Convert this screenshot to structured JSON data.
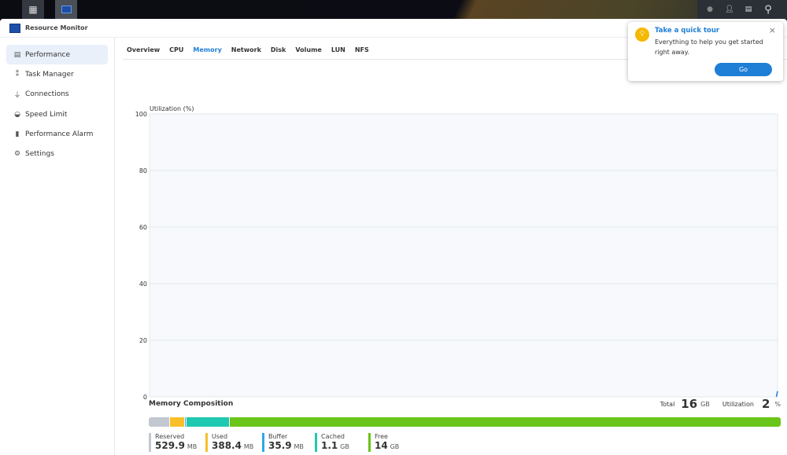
{
  "window": {
    "title": "Resource Monitor"
  },
  "sidebar": {
    "items": [
      {
        "label": "Performance",
        "icon": "performance-icon",
        "active": true
      },
      {
        "label": "Task Manager",
        "icon": "task-manager-icon"
      },
      {
        "label": "Connections",
        "icon": "plug-icon"
      },
      {
        "label": "Speed Limit",
        "icon": "gauge-icon"
      },
      {
        "label": "Performance Alarm",
        "icon": "alarm-icon"
      },
      {
        "label": "Settings",
        "icon": "gear-icon"
      }
    ]
  },
  "tabs": [
    "Overview",
    "CPU",
    "Memory",
    "Network",
    "Disk",
    "Volume",
    "LUN",
    "NFS"
  ],
  "active_tab": "Memory",
  "chart_data": {
    "type": "line",
    "ylabel": "Utilization (%)",
    "ylim": [
      0,
      100
    ],
    "yticks": [
      0,
      20,
      40,
      60,
      80,
      100
    ],
    "grid": true,
    "series": [
      {
        "values": [
          0,
          2
        ]
      }
    ],
    "color": "#1f7ed6"
  },
  "composition": {
    "title": "Memory Composition",
    "total_label": "Total",
    "total_value": "16",
    "total_unit": "GB",
    "util_label": "Utilization",
    "util_value": "2",
    "util_unit": "%",
    "items": [
      {
        "label": "Reserved",
        "value": "529.9",
        "unit": "MB",
        "color": "#c2c8cf",
        "mb": 529.9
      },
      {
        "label": "Used",
        "value": "388.4",
        "unit": "MB",
        "color": "#f8bf2a",
        "mb": 388.4
      },
      {
        "label": "Buffer",
        "value": "35.9",
        "unit": "MB",
        "color": "#30a7e6",
        "mb": 35.9
      },
      {
        "label": "Cached",
        "value": "1.1",
        "unit": "GB",
        "color": "#1fc8b0",
        "mb": 1126
      },
      {
        "label": "Free",
        "value": "14",
        "unit": "GB",
        "color": "#69c519",
        "mb": 14336
      }
    ]
  },
  "popup": {
    "title": "Take a quick tour",
    "body": "Everything to help you get started right away.",
    "button": "Go",
    "accent": "#1f7ed6"
  }
}
